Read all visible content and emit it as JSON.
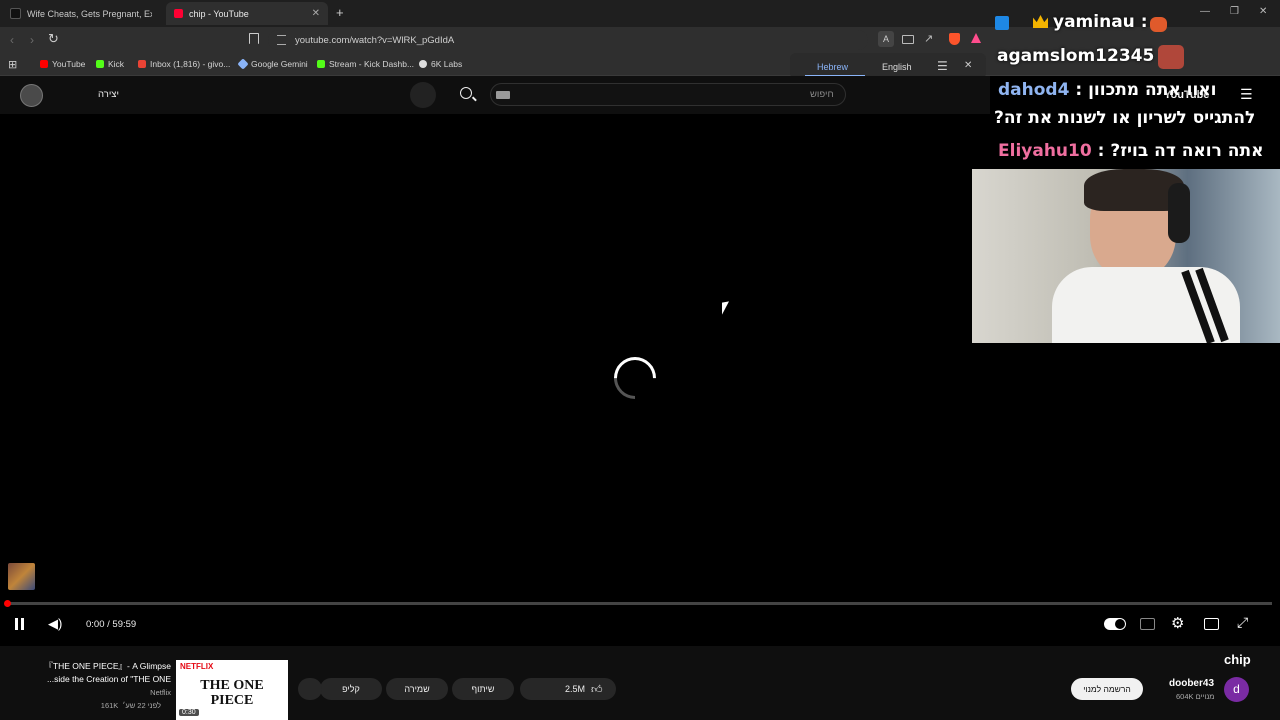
{
  "browser": {
    "tabs": [
      {
        "label": "Wife Cheats, Gets Pregnant, Expects",
        "active": false,
        "icon": "tiktok-icon"
      },
      {
        "label": "chip - YouTube",
        "active": true,
        "icon": "youtube-icon"
      }
    ],
    "new_tab_symbol": "+",
    "url": "youtube.com/watch?v=WlRK_pGdIdA",
    "bookmarks": [
      {
        "label": "YouTube",
        "icon": "youtube-icon",
        "color": "#ff0000"
      },
      {
        "label": "Kick",
        "icon": "kick-icon",
        "color": "#53fc18"
      },
      {
        "label": "Inbox (1,816) - givo...",
        "icon": "gmail-icon",
        "color": "#ea4335"
      },
      {
        "label": "Google Gemini",
        "icon": "gemini-icon",
        "color": "#8ab4f8"
      },
      {
        "label": "Stream - Kick Dashb...",
        "icon": "kick-icon",
        "color": "#53fc18"
      },
      {
        "label": "6K Labs",
        "icon": "labs-icon",
        "color": "#dddddd"
      }
    ],
    "translate": {
      "source": "Hebrew",
      "target": "English"
    }
  },
  "youtube": {
    "create_label": "יצירה",
    "search_placeholder": "חיפוש",
    "logo_text": "YouTube",
    "player": {
      "elapsed": "0:00",
      "separator": " / ",
      "duration": "59:59",
      "progress_fraction": 0.0
    },
    "video_title": "chip",
    "channel": {
      "name": "doober43",
      "subscribers": "604K מנויים",
      "avatar_letter": "d"
    },
    "subscribe_label": "הרשמה למנוי",
    "likes": "2.5M",
    "share_label": "שיתוף",
    "save_label": "שמירה",
    "clip_label": "קליפ",
    "recommendation": {
      "title_line1": "『THE ONE PIECE』- A Glimpse",
      "title_line2": "...side the Creation of \"THE ONE",
      "channel": "Netflix",
      "meta": "161K  לפני 22 שע׳",
      "thumb_brand": "NETFLIX",
      "thumb_title": "THE ONE PIECE",
      "duration": "0:30"
    }
  },
  "overlay": {
    "chat": [
      {
        "user": "yaminau",
        "message": "",
        "user_color": "#ffffff"
      },
      {
        "user": "agamslom12345",
        "message": "",
        "user_color": "#ffffff"
      },
      {
        "user": "dahod4",
        "message": "ואוו אתה מתכוון",
        "user_color": "#8fb4f0"
      },
      {
        "user": "",
        "message": "?להתגייס לשריון או לשנות את זה",
        "user_color": "#ffffff"
      },
      {
        "user": "Eliyahu10",
        "message": "?אתה רואה דה בויז",
        "user_color": "#f06fa0"
      }
    ],
    "chat_separator": " : "
  }
}
